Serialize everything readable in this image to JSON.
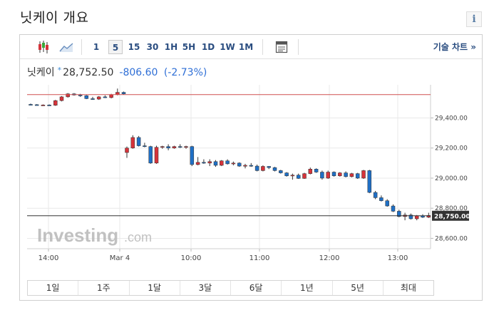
{
  "page": {
    "title": "닛케이 개요",
    "info_label": "i"
  },
  "toolbar": {
    "timeframes": [
      "1",
      "5",
      "15",
      "30",
      "1H",
      "5H",
      "1D",
      "1W",
      "1M"
    ],
    "active_timeframe": "5",
    "tech_chart_label": "기술 차트 »",
    "icons": [
      "candlestick-icon",
      "line-chart-icon",
      "settings-panel-icon"
    ]
  },
  "quote": {
    "name": "닛케이",
    "marker": "*",
    "price": "28,752.50",
    "change": "-806.60",
    "change_pct": "(-2.73%)",
    "change_color": "#2f6fd6"
  },
  "colors": {
    "up": "#d6333a",
    "down": "#1f6fc5",
    "grid": "#e9e9e9",
    "ref_line": "#d05050",
    "current_bg": "#333333"
  },
  "watermark": {
    "brand": "Investing",
    "suffix": ".com"
  },
  "ranges": [
    "1일",
    "1주",
    "1달",
    "3달",
    "6달",
    "1년",
    "5년",
    "최대"
  ],
  "chart_data": {
    "type": "candlestick",
    "y_ticks": [
      29400,
      29200,
      29000,
      28800,
      28600
    ],
    "y_tick_labels": [
      "29,400.00",
      "29,200.00",
      "29,000.00",
      "28,800.00",
      "28,600.00"
    ],
    "ylim": [
      28550,
      29620
    ],
    "x_labels": [
      "14:00",
      "Mar 4",
      "10:00",
      "11:00",
      "12:00",
      "13:00"
    ],
    "reference_line": 29555,
    "current_value": 28750,
    "current_label": "28,750.00",
    "grid": true,
    "candles": [
      [
        29490,
        29495,
        29485,
        29488
      ],
      [
        29488,
        29492,
        29482,
        29485
      ],
      [
        29485,
        29490,
        29482,
        29486
      ],
      [
        29486,
        29490,
        29482,
        29484
      ],
      [
        29484,
        29520,
        29480,
        29515
      ],
      [
        29515,
        29545,
        29510,
        29540
      ],
      [
        29540,
        29565,
        29535,
        29560
      ],
      [
        29560,
        29565,
        29548,
        29552
      ],
      [
        29552,
        29560,
        29540,
        29548
      ],
      [
        29548,
        29552,
        29525,
        29528
      ],
      [
        29528,
        29540,
        29520,
        29525
      ],
      [
        29525,
        29545,
        29520,
        29540
      ],
      [
        29540,
        29550,
        29532,
        29535
      ],
      [
        29535,
        29560,
        29530,
        29555
      ],
      [
        29555,
        29595,
        29550,
        29570
      ],
      [
        29570,
        29575,
        29555,
        29560
      ],
      [
        29170,
        29210,
        29135,
        29200
      ],
      [
        29200,
        29285,
        29195,
        29270
      ],
      [
        29270,
        29280,
        29210,
        29215
      ],
      [
        29215,
        29235,
        29205,
        29210
      ],
      [
        29210,
        29215,
        29095,
        29100
      ],
      [
        29100,
        29215,
        29095,
        29205
      ],
      [
        29205,
        29215,
        29195,
        29210
      ],
      [
        29210,
        29225,
        29185,
        29200
      ],
      [
        29200,
        29215,
        29195,
        29210
      ],
      [
        29210,
        29225,
        29200,
        29205
      ],
      [
        29205,
        29215,
        29195,
        29210
      ],
      [
        29210,
        29215,
        29080,
        29090
      ],
      [
        29090,
        29140,
        29085,
        29105
      ],
      [
        29105,
        29125,
        29095,
        29100
      ],
      [
        29100,
        29125,
        29080,
        29110
      ],
      [
        29110,
        29120,
        29075,
        29085
      ],
      [
        29085,
        29120,
        29080,
        29115
      ],
      [
        29115,
        29125,
        29090,
        29095
      ],
      [
        29095,
        29110,
        29085,
        29100
      ],
      [
        29100,
        29105,
        29075,
        29080
      ],
      [
        29080,
        29095,
        29065,
        29085
      ],
      [
        29085,
        29100,
        29075,
        29080
      ],
      [
        29080,
        29090,
        29045,
        29050
      ],
      [
        29050,
        29085,
        29045,
        29078
      ],
      [
        29078,
        29080,
        29060,
        29070
      ],
      [
        29070,
        29075,
        29045,
        29050
      ],
      [
        29050,
        29055,
        29030,
        29035
      ],
      [
        29035,
        29040,
        29010,
        29015
      ],
      [
        29015,
        29030,
        28990,
        29020
      ],
      [
        29020,
        29030,
        28995,
        28998
      ],
      [
        28998,
        29035,
        28995,
        29030
      ],
      [
        29030,
        29070,
        29025,
        29060
      ],
      [
        29060,
        29065,
        29035,
        29040
      ],
      [
        29040,
        29050,
        28990,
        29000
      ],
      [
        29000,
        29050,
        28995,
        29040
      ],
      [
        29040,
        29045,
        29010,
        29015
      ],
      [
        29015,
        29040,
        29010,
        29035
      ],
      [
        29035,
        29045,
        29005,
        29010
      ],
      [
        29010,
        29035,
        29005,
        29030
      ],
      [
        29030,
        29035,
        28995,
        29000
      ],
      [
        29000,
        29055,
        28995,
        29050
      ],
      [
        29050,
        29055,
        28900,
        28905
      ],
      [
        28905,
        28915,
        28860,
        28870
      ],
      [
        28870,
        28885,
        28845,
        28850
      ],
      [
        28850,
        28860,
        28810,
        28815
      ],
      [
        28815,
        28825,
        28775,
        28780
      ],
      [
        28780,
        28790,
        28740,
        28745
      ],
      [
        28745,
        28770,
        28720,
        28755
      ],
      [
        28755,
        28765,
        28725,
        28730
      ],
      [
        28730,
        28755,
        28720,
        28750
      ],
      [
        28750,
        28760,
        28735,
        28740
      ],
      [
        28740,
        28770,
        28735,
        28752
      ]
    ]
  }
}
